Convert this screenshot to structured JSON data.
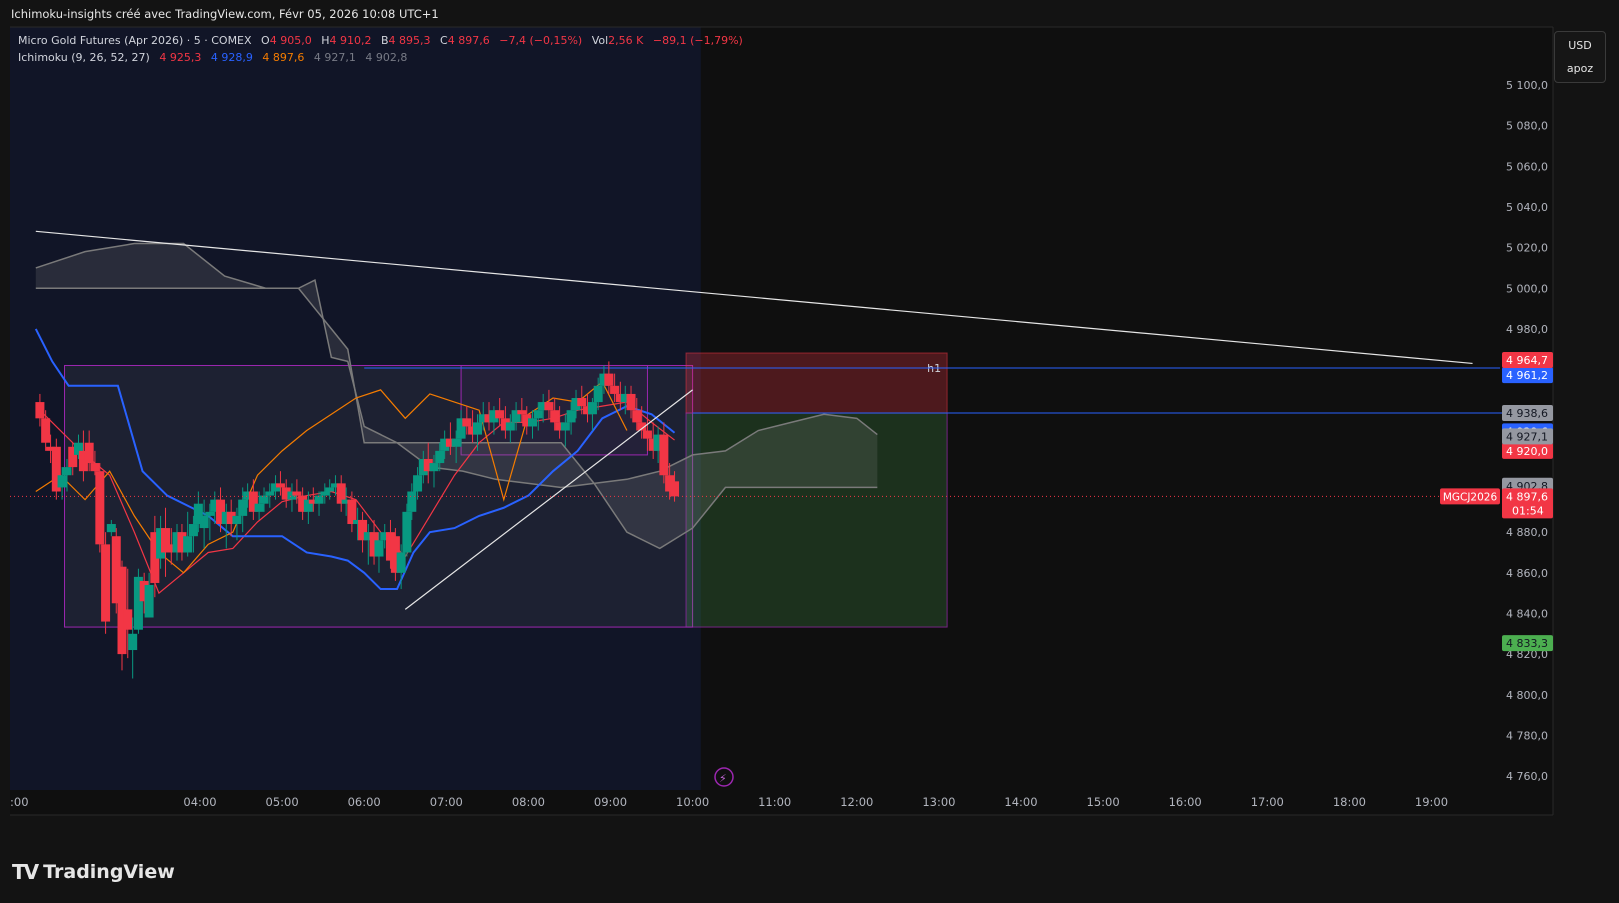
{
  "header": {
    "attribution": "Ichimoku-insights créé avec TradingView.com, Févr 05, 2026 10:08 UTC+1"
  },
  "legend": {
    "symbol": "Micro Gold Futures (Apr 2026) · 5 · COMEX",
    "o_label": "O",
    "o_value": "4 905,0",
    "h_label": "H",
    "h_value": "4 910,2",
    "b_label": "B",
    "b_value": "4 895,3",
    "c_label": "C",
    "c_value": "4 897,6",
    "change": "−7,4 (−0,15%)",
    "vol_label": "Vol",
    "vol_value": "2,56 K",
    "vol_change": "−89,1 (−1,79%)",
    "ichimoku_label": "Ichimoku (9, 26, 52, 27)",
    "ichi_conversion": "4 925,3",
    "ichi_base": "4 928,9",
    "ichi_lagging": "4 897,6",
    "ichi_span_a": "4 927,1",
    "ichi_span_b": "4 902,8"
  },
  "currency_box": {
    "currency": "USD",
    "user": "apoz"
  },
  "price_labels": {
    "symbol_tag": "MGCJ2026",
    "last": "4 897,6",
    "countdown": "01:54",
    "target_high": "4 964,7",
    "level_mid": "4 938,6",
    "span_a": "4 927,1",
    "span_b": "4 902,8",
    "target_low": "4 833,3",
    "hidden_1": "4 961,2",
    "hidden_2": "4 929,6",
    "hidden_3": "4 920,0"
  },
  "annotations": {
    "box_label": "h1"
  },
  "branding": {
    "logo_text": "TradingView"
  },
  "colors": {
    "up": "#089981",
    "down": "#f23645",
    "conversion": "#f23645",
    "base": "#2962ff",
    "lagging": "#f57c00",
    "cloud": "#808080",
    "level_line": "#2962ff",
    "box": "#9c27b0",
    "label_red": "#f23645",
    "label_green": "#4caf50"
  },
  "chart_data": {
    "type": "candlestick",
    "title": "Micro Gold Futures (Apr 2026) · 5 · COMEX",
    "xlabel": "",
    "ylabel": "",
    "ylim": [
      4750,
      5110
    ],
    "y_ticks": [
      "5 100,0",
      "5 080,0",
      "5 060,0",
      "5 040,0",
      "5 020,0",
      "5 000,0",
      "4 980,0",
      "4 960,0",
      "4 940,0",
      "4 920,0",
      "4 900,0",
      "4 880,0",
      "4 860,0",
      "4 840,0",
      "4 820,0",
      "4 800,0",
      "4 780,0",
      "4 760,0"
    ],
    "y_tick_values": [
      5100,
      5080,
      5060,
      5040,
      5020,
      5000,
      4980,
      4960,
      4940,
      4920,
      4900,
      4880,
      4860,
      4840,
      4820,
      4800,
      4780,
      4760
    ],
    "x_ticks": [
      ":00",
      "04:00",
      "05:00",
      "06:00",
      "07:00",
      "08:00",
      "09:00",
      "10:00",
      "11:00",
      "12:00",
      "13:00",
      "14:00",
      "15:00",
      "16:00",
      "17:00",
      "18:00",
      "19:00"
    ],
    "x_tick_hours": [
      2.17,
      4.0,
      5.0,
      6.0,
      7.0,
      8.0,
      9.0,
      10.0,
      11.0,
      12.0,
      13.0,
      14.0,
      15.0,
      16.0,
      17.0,
      18.0,
      19.0
    ],
    "time_range_hours": [
      2.0,
      19.5
    ],
    "last_bar_hour": 10.1,
    "candles": [
      [
        2.05,
        4944,
        4948,
        4932,
        4936
      ],
      [
        2.12,
        4936,
        4940,
        4920,
        4924
      ],
      [
        2.18,
        4922,
        4928,
        4914,
        4920
      ],
      [
        2.25,
        4922,
        4926,
        4896,
        4900
      ],
      [
        2.32,
        4902,
        4912,
        4896,
        4908
      ],
      [
        2.38,
        4908,
        4916,
        4900,
        4912
      ],
      [
        2.45,
        4922,
        4924,
        4908,
        4912
      ],
      [
        2.52,
        4918,
        4928,
        4916,
        4924
      ],
      [
        2.58,
        4920,
        4930,
        4905,
        4910
      ],
      [
        2.65,
        4924,
        4930,
        4910,
        4914
      ],
      [
        2.72,
        4914,
        4920,
        4908,
        4910
      ],
      [
        2.78,
        4910,
        4914,
        4870,
        4874
      ],
      [
        2.85,
        4874,
        4880,
        4830,
        4836
      ],
      [
        2.92,
        4880,
        4886,
        4878,
        4884
      ],
      [
        2.98,
        4878,
        4882,
        4840,
        4845
      ],
      [
        3.05,
        4863,
        4866,
        4812,
        4820
      ],
      [
        3.12,
        4842,
        4862,
        4818,
        4832
      ],
      [
        3.18,
        4822,
        4838,
        4808,
        4830
      ],
      [
        3.25,
        4832,
        4862,
        4830,
        4858
      ],
      [
        3.32,
        4856,
        4860,
        4840,
        4846
      ],
      [
        3.38,
        4838,
        4860,
        4838,
        4854
      ],
      [
        3.45,
        4880,
        4888,
        4848,
        4855
      ],
      [
        3.52,
        4867,
        4888,
        4862,
        4882
      ],
      [
        3.58,
        4882,
        4892,
        4858,
        4870
      ],
      [
        3.65,
        4874,
        4882,
        4864,
        4870
      ],
      [
        3.72,
        4870,
        4884,
        4866,
        4880
      ],
      [
        3.78,
        4880,
        4884,
        4866,
        4870
      ],
      [
        3.85,
        4870,
        4890,
        4868,
        4878
      ],
      [
        3.92,
        4878,
        4888,
        4870,
        4884
      ],
      [
        3.98,
        4884,
        4900,
        4880,
        4894
      ],
      [
        4.05,
        4882,
        4896,
        4872,
        4888
      ],
      [
        4.12,
        4888,
        4894,
        4876,
        4890
      ],
      [
        4.18,
        4890,
        4900,
        4884,
        4896
      ],
      [
        4.25,
        4896,
        4902,
        4880,
        4884
      ],
      [
        4.32,
        4884,
        4894,
        4872,
        4890
      ],
      [
        4.38,
        4890,
        4896,
        4878,
        4884
      ],
      [
        4.45,
        4884,
        4892,
        4876,
        4888
      ],
      [
        4.52,
        4888,
        4902,
        4880,
        4896
      ],
      [
        4.58,
        4896,
        4904,
        4892,
        4900
      ],
      [
        4.65,
        4900,
        4906,
        4886,
        4890
      ],
      [
        4.72,
        4890,
        4900,
        4886,
        4894
      ],
      [
        4.78,
        4894,
        4902,
        4890,
        4898
      ],
      [
        4.85,
        4898,
        4904,
        4892,
        4900
      ],
      [
        4.92,
        4900,
        4908,
        4896,
        4904
      ],
      [
        4.98,
        4904,
        4910,
        4898,
        4902
      ],
      [
        5.05,
        4902,
        4906,
        4892,
        4896
      ],
      [
        5.12,
        4896,
        4904,
        4890,
        4900
      ],
      [
        5.18,
        4900,
        4906,
        4894,
        4898
      ],
      [
        5.25,
        4898,
        4902,
        4886,
        4890
      ],
      [
        5.32,
        4890,
        4900,
        4884,
        4896
      ],
      [
        5.38,
        4896,
        4902,
        4890,
        4894
      ],
      [
        5.45,
        4894,
        4900,
        4888,
        4898
      ],
      [
        5.52,
        4898,
        4904,
        4894,
        4900
      ],
      [
        5.58,
        4900,
        4906,
        4896,
        4902
      ],
      [
        5.65,
        4902,
        4908,
        4898,
        4904
      ],
      [
        5.72,
        4904,
        4908,
        4890,
        4894
      ],
      [
        5.78,
        4894,
        4902,
        4888,
        4896
      ],
      [
        5.85,
        4896,
        4900,
        4880,
        4884
      ],
      [
        5.92,
        4884,
        4892,
        4876,
        4886
      ],
      [
        5.98,
        4886,
        4890,
        4870,
        4876
      ],
      [
        6.05,
        4876,
        4884,
        4864,
        4880
      ],
      [
        6.12,
        4880,
        4886,
        4864,
        4868
      ],
      [
        6.18,
        4868,
        4880,
        4860,
        4876
      ],
      [
        6.25,
        4876,
        4884,
        4872,
        4880
      ],
      [
        6.32,
        4880,
        4886,
        4862,
        4866
      ],
      [
        6.38,
        4878,
        4882,
        4856,
        4860
      ],
      [
        6.45,
        4860,
        4874,
        4852,
        4870
      ],
      [
        6.52,
        4870,
        4894,
        4868,
        4890
      ],
      [
        6.58,
        4890,
        4904,
        4886,
        4900
      ],
      [
        6.65,
        4900,
        4912,
        4896,
        4908
      ],
      [
        6.72,
        4908,
        4920,
        4904,
        4916
      ],
      [
        6.78,
        4916,
        4924,
        4904,
        4910
      ],
      [
        6.85,
        4910,
        4918,
        4902,
        4914
      ],
      [
        6.92,
        4914,
        4924,
        4910,
        4920
      ],
      [
        6.98,
        4920,
        4930,
        4916,
        4926
      ],
      [
        7.05,
        4926,
        4934,
        4918,
        4922
      ],
      [
        7.12,
        4922,
        4930,
        4914,
        4926
      ],
      [
        7.18,
        4926,
        4940,
        4922,
        4936
      ],
      [
        7.25,
        4936,
        4942,
        4928,
        4932
      ],
      [
        7.32,
        4932,
        4940,
        4924,
        4928
      ],
      [
        7.38,
        4928,
        4938,
        4920,
        4934
      ],
      [
        7.45,
        4934,
        4944,
        4930,
        4938
      ],
      [
        7.52,
        4938,
        4944,
        4930,
        4934
      ],
      [
        7.58,
        4934,
        4942,
        4928,
        4940
      ],
      [
        7.65,
        4940,
        4946,
        4932,
        4936
      ],
      [
        7.72,
        4936,
        4942,
        4926,
        4930
      ],
      [
        7.78,
        4930,
        4938,
        4924,
        4934
      ],
      [
        7.85,
        4934,
        4944,
        4930,
        4940
      ],
      [
        7.92,
        4940,
        4946,
        4934,
        4938
      ],
      [
        7.98,
        4938,
        4942,
        4928,
        4932
      ],
      [
        8.05,
        4932,
        4940,
        4926,
        4936
      ],
      [
        8.12,
        4936,
        4944,
        4930,
        4940
      ],
      [
        8.18,
        4940,
        4948,
        4934,
        4944
      ],
      [
        8.25,
        4944,
        4950,
        4936,
        4940
      ],
      [
        8.32,
        4940,
        4946,
        4930,
        4934
      ],
      [
        8.38,
        4934,
        4942,
        4926,
        4930
      ],
      [
        8.45,
        4930,
        4938,
        4922,
        4934
      ],
      [
        8.52,
        4934,
        4944,
        4928,
        4940
      ],
      [
        8.58,
        4940,
        4950,
        4936,
        4946
      ],
      [
        8.65,
        4946,
        4952,
        4938,
        4942
      ],
      [
        8.72,
        4942,
        4948,
        4934,
        4938
      ],
      [
        8.78,
        4938,
        4946,
        4930,
        4944
      ],
      [
        8.85,
        4944,
        4956,
        4940,
        4952
      ],
      [
        8.92,
        4952,
        4962,
        4948,
        4958
      ],
      [
        8.98,
        4958,
        4964,
        4948,
        4952
      ],
      [
        9.05,
        4952,
        4958,
        4944,
        4948
      ],
      [
        9.12,
        4948,
        4954,
        4940,
        4944
      ],
      [
        9.18,
        4944,
        4952,
        4938,
        4948
      ],
      [
        9.25,
        4948,
        4952,
        4936,
        4940
      ],
      [
        9.32,
        4940,
        4946,
        4930,
        4934
      ],
      [
        9.38,
        4934,
        4942,
        4926,
        4930
      ],
      [
        9.45,
        4930,
        4936,
        4920,
        4926
      ],
      [
        9.52,
        4926,
        4934,
        4916,
        4920
      ],
      [
        9.58,
        4920,
        4932,
        4914,
        4928
      ],
      [
        9.65,
        4928,
        4934,
        4904,
        4908
      ],
      [
        9.72,
        4908,
        4914,
        4896,
        4900
      ],
      [
        9.78,
        4905,
        4910,
        4895,
        4897.6
      ]
    ],
    "series": [
      {
        "name": "Conversion",
        "x": [
          2.0,
          2.3,
          2.6,
          2.9,
          3.2,
          3.5,
          3.8,
          4.1,
          4.4,
          4.7,
          5.0,
          5.3,
          5.6,
          5.9,
          6.2,
          6.5,
          6.8,
          7.1,
          7.4,
          7.7,
          8.0,
          8.3,
          8.6,
          8.9,
          9.2,
          9.5,
          9.78
        ],
        "y": [
          4942,
          4930,
          4918,
          4908,
          4880,
          4850,
          4860,
          4870,
          4872,
          4885,
          4895,
          4898,
          4900,
          4896,
          4880,
          4868,
          4888,
          4908,
          4924,
          4934,
          4934,
          4936,
          4940,
          4942,
          4944,
          4934,
          4925.3
        ]
      },
      {
        "name": "Base",
        "x": [
          2.0,
          2.2,
          2.4,
          2.7,
          3.0,
          3.3,
          3.6,
          3.9,
          4.1,
          4.4,
          4.7,
          5.0,
          5.3,
          5.6,
          5.8,
          6.0,
          6.2,
          6.4,
          6.6,
          6.8,
          7.1,
          7.4,
          7.7,
          8.0,
          8.3,
          8.6,
          8.9,
          9.2,
          9.5,
          9.78
        ],
        "y": [
          4980,
          4964,
          4952,
          4952,
          4952,
          4910,
          4898,
          4892,
          4888,
          4878,
          4878,
          4878,
          4870,
          4868,
          4866,
          4860,
          4852,
          4852,
          4870,
          4880,
          4882,
          4888,
          4892,
          4898,
          4910,
          4920,
          4936,
          4942,
          4938,
          4928.9
        ]
      },
      {
        "name": "Lagging",
        "x": [
          2.0,
          2.3,
          2.6,
          2.9,
          3.2,
          3.5,
          3.8,
          4.1,
          4.4,
          4.7,
          5.0,
          5.3,
          5.6,
          5.9,
          6.2,
          6.5,
          6.8,
          7.1,
          7.4,
          7.7,
          8.0,
          8.3,
          8.6,
          8.9,
          9.2
        ],
        "y": [
          4900,
          4908,
          4896,
          4910,
          4888,
          4870,
          4860,
          4874,
          4880,
          4908,
          4920,
          4930,
          4938,
          4946,
          4950,
          4936,
          4948,
          4944,
          4940,
          4896,
          4938,
          4946,
          4944,
          4954,
          4930
        ]
      },
      {
        "name": "Span A",
        "x": [
          2.0,
          2.6,
          3.2,
          3.8,
          4.3,
          4.8,
          5.2,
          5.4,
          5.6,
          5.8,
          6.0,
          6.4,
          6.8,
          7.2,
          7.6,
          8.0,
          8.4,
          8.8,
          9.2,
          9.6,
          10.0,
          10.4,
          10.8,
          11.2,
          11.6,
          12.0,
          12.25
        ],
        "y": [
          5010,
          5018,
          5022,
          5022,
          5006,
          5000,
          5000,
          5004,
          4966,
          4964,
          4932,
          4924,
          4912,
          4910,
          4906,
          4904,
          4902,
          4904,
          4906,
          4910,
          4918,
          4920,
          4930,
          4934,
          4938,
          4936,
          4928
        ]
      },
      {
        "name": "Span B",
        "x": [
          2.0,
          2.6,
          3.2,
          3.8,
          4.3,
          4.8,
          5.2,
          5.4,
          5.6,
          5.8,
          6.0,
          6.4,
          6.8,
          7.2,
          7.6,
          8.0,
          8.4,
          8.8,
          9.2,
          9.6,
          10.0,
          10.4,
          10.8,
          11.2,
          11.6,
          12.0,
          12.25
        ],
        "y": [
          5000,
          5000,
          5000,
          5000,
          5000,
          5000,
          5000,
          4990,
          4980,
          4970,
          4924,
          4924,
          4924,
          4924,
          4924,
          4924,
          4924,
          4904,
          4880,
          4872,
          4882,
          4902,
          4902,
          4902,
          4902,
          4902,
          4902
        ]
      }
    ],
    "horizontal_levels": [
      4964.7,
      4938.6,
      4897.6
    ],
    "trendline_down": {
      "x": [
        2.0,
        19.5
      ],
      "y": [
        5028,
        4963
      ]
    },
    "trendline_up": {
      "x": [
        6.5,
        10.0
      ],
      "y": [
        4842,
        4950
      ]
    },
    "range_box": {
      "x": [
        2.35,
        10.0
      ],
      "y": [
        4962,
        4833.3
      ]
    },
    "inner_box": {
      "x": [
        7.18,
        9.45
      ],
      "y": [
        4962,
        4918
      ]
    },
    "position": {
      "entry": 4938.6,
      "stop": 4964.7,
      "target": 4833.3,
      "x": [
        9.92,
        13.1
      ]
    },
    "session_shade_end": 10.1
  }
}
